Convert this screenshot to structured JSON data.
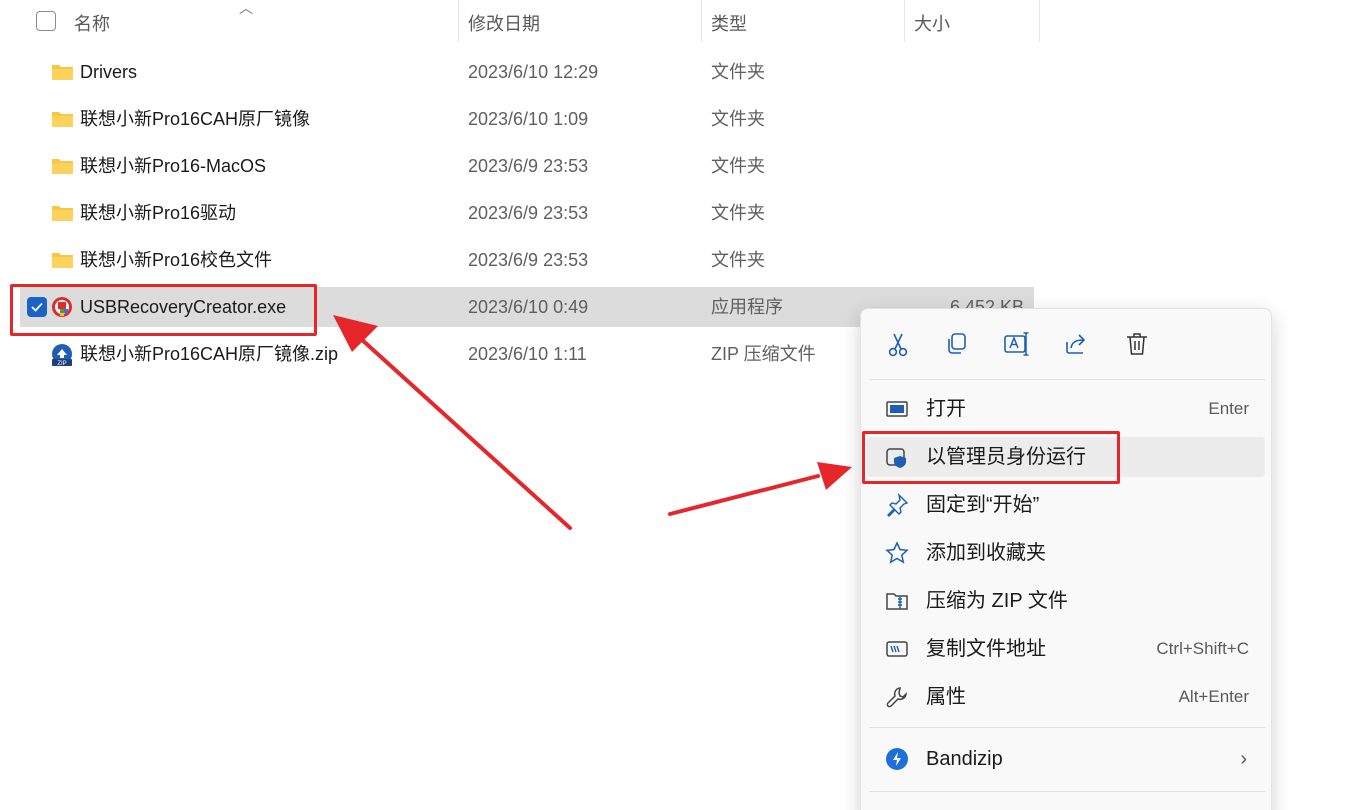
{
  "header": {
    "name": "名称",
    "date": "修改日期",
    "type": "类型",
    "size": "大小"
  },
  "files": [
    {
      "name": "Drivers",
      "date": "2023/6/10 12:29",
      "type": "文件夹",
      "size": "",
      "icon": "folder-icon"
    },
    {
      "name": "联想小新Pro16CAH原厂镜像",
      "date": "2023/6/10 1:09",
      "type": "文件夹",
      "size": "",
      "icon": "folder-icon"
    },
    {
      "name": "联想小新Pro16-MacOS",
      "date": "2023/6/9 23:53",
      "type": "文件夹",
      "size": "",
      "icon": "folder-icon"
    },
    {
      "name": "联想小新Pro16驱动",
      "date": "2023/6/9 23:53",
      "type": "文件夹",
      "size": "",
      "icon": "folder-icon"
    },
    {
      "name": "联想小新Pro16校色文件",
      "date": "2023/6/9 23:53",
      "type": "文件夹",
      "size": "",
      "icon": "folder-icon"
    },
    {
      "name": "USBRecoveryCreator.exe",
      "date": "2023/6/10 0:49",
      "type": "应用程序",
      "size": "6,452 KB",
      "icon": "app-icon"
    },
    {
      "name": "联想小新Pro16CAH原厂镜像.zip",
      "date": "2023/6/10 1:11",
      "type": "ZIP 压缩文件",
      "size": "",
      "icon": "zip-icon"
    }
  ],
  "context_menu": {
    "toolbar": [
      "cut-icon",
      "copy-icon",
      "rename-icon",
      "share-icon",
      "delete-icon"
    ],
    "items": [
      {
        "label": "打开",
        "shortcut": "Enter",
        "icon": "open-icon"
      },
      {
        "label": "以管理员身份运行",
        "shortcut": "",
        "icon": "admin-shield-icon"
      },
      {
        "label": "固定到“开始”",
        "shortcut": "",
        "icon": "pin-icon"
      },
      {
        "label": "添加到收藏夹",
        "shortcut": "",
        "icon": "star-icon"
      },
      {
        "label": "压缩为 ZIP 文件",
        "shortcut": "",
        "icon": "zip-folder-icon"
      },
      {
        "label": "复制文件地址",
        "shortcut": "Ctrl+Shift+C",
        "icon": "copy-path-icon"
      },
      {
        "label": "属性",
        "shortcut": "Alt+Enter",
        "icon": "wrench-icon"
      },
      {
        "label": "Bandizip",
        "shortcut": "",
        "icon": "bandizip-icon"
      }
    ]
  },
  "colors": {
    "highlight_red": "#e5262b",
    "selection_gray": "#dcdcdc",
    "checkbox_blue": "#1a62c5",
    "folder_yellow": "#f6c644"
  }
}
